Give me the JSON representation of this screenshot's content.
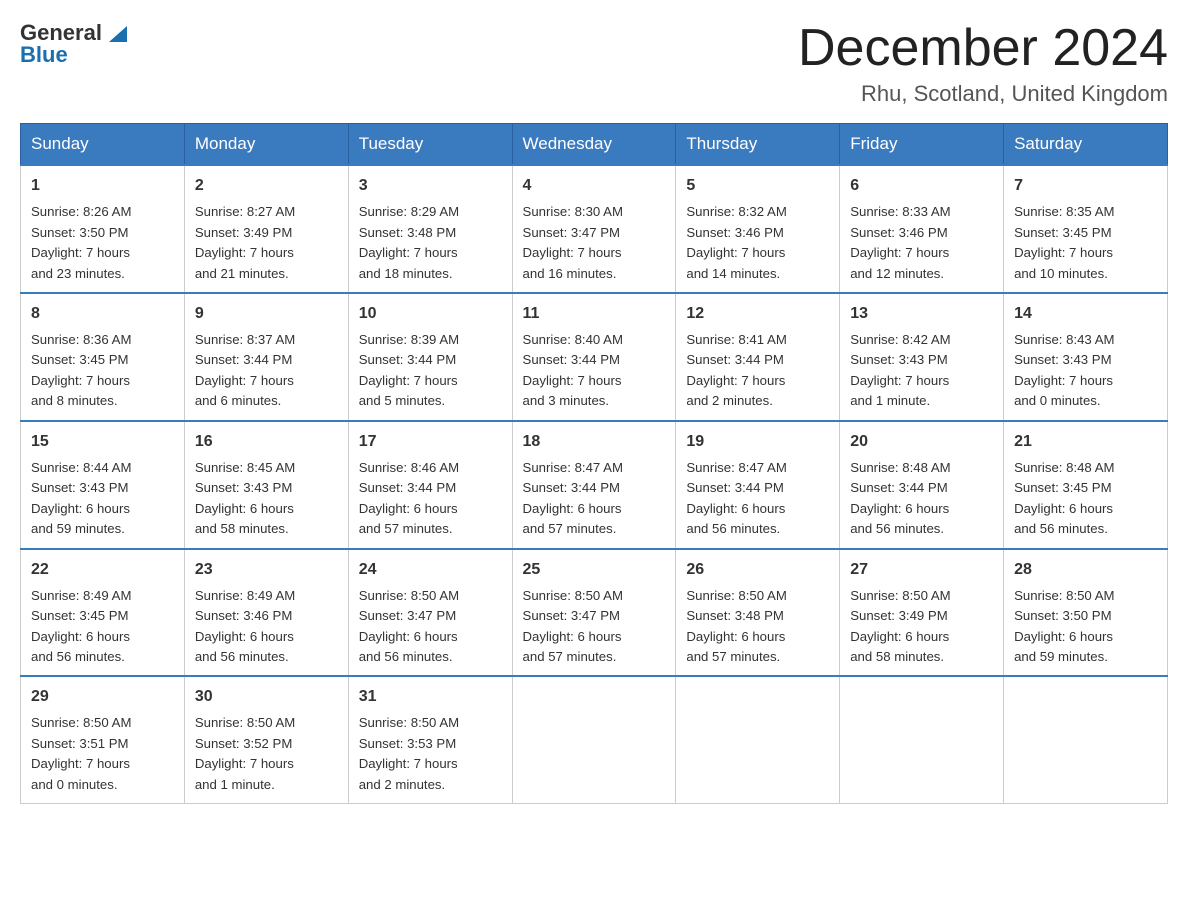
{
  "logo": {
    "text_general": "General",
    "text_blue": "Blue"
  },
  "title": "December 2024",
  "location": "Rhu, Scotland, United Kingdom",
  "days_of_week": [
    "Sunday",
    "Monday",
    "Tuesday",
    "Wednesday",
    "Thursday",
    "Friday",
    "Saturday"
  ],
  "weeks": [
    [
      {
        "date": "1",
        "sunrise": "8:26 AM",
        "sunset": "3:50 PM",
        "daylight": "7 hours and 23 minutes."
      },
      {
        "date": "2",
        "sunrise": "8:27 AM",
        "sunset": "3:49 PM",
        "daylight": "7 hours and 21 minutes."
      },
      {
        "date": "3",
        "sunrise": "8:29 AM",
        "sunset": "3:48 PM",
        "daylight": "7 hours and 18 minutes."
      },
      {
        "date": "4",
        "sunrise": "8:30 AM",
        "sunset": "3:47 PM",
        "daylight": "7 hours and 16 minutes."
      },
      {
        "date": "5",
        "sunrise": "8:32 AM",
        "sunset": "3:46 PM",
        "daylight": "7 hours and 14 minutes."
      },
      {
        "date": "6",
        "sunrise": "8:33 AM",
        "sunset": "3:46 PM",
        "daylight": "7 hours and 12 minutes."
      },
      {
        "date": "7",
        "sunrise": "8:35 AM",
        "sunset": "3:45 PM",
        "daylight": "7 hours and 10 minutes."
      }
    ],
    [
      {
        "date": "8",
        "sunrise": "8:36 AM",
        "sunset": "3:45 PM",
        "daylight": "7 hours and 8 minutes."
      },
      {
        "date": "9",
        "sunrise": "8:37 AM",
        "sunset": "3:44 PM",
        "daylight": "7 hours and 6 minutes."
      },
      {
        "date": "10",
        "sunrise": "8:39 AM",
        "sunset": "3:44 PM",
        "daylight": "7 hours and 5 minutes."
      },
      {
        "date": "11",
        "sunrise": "8:40 AM",
        "sunset": "3:44 PM",
        "daylight": "7 hours and 3 minutes."
      },
      {
        "date": "12",
        "sunrise": "8:41 AM",
        "sunset": "3:44 PM",
        "daylight": "7 hours and 2 minutes."
      },
      {
        "date": "13",
        "sunrise": "8:42 AM",
        "sunset": "3:43 PM",
        "daylight": "7 hours and 1 minute."
      },
      {
        "date": "14",
        "sunrise": "8:43 AM",
        "sunset": "3:43 PM",
        "daylight": "7 hours and 0 minutes."
      }
    ],
    [
      {
        "date": "15",
        "sunrise": "8:44 AM",
        "sunset": "3:43 PM",
        "daylight": "6 hours and 59 minutes."
      },
      {
        "date": "16",
        "sunrise": "8:45 AM",
        "sunset": "3:43 PM",
        "daylight": "6 hours and 58 minutes."
      },
      {
        "date": "17",
        "sunrise": "8:46 AM",
        "sunset": "3:44 PM",
        "daylight": "6 hours and 57 minutes."
      },
      {
        "date": "18",
        "sunrise": "8:47 AM",
        "sunset": "3:44 PM",
        "daylight": "6 hours and 57 minutes."
      },
      {
        "date": "19",
        "sunrise": "8:47 AM",
        "sunset": "3:44 PM",
        "daylight": "6 hours and 56 minutes."
      },
      {
        "date": "20",
        "sunrise": "8:48 AM",
        "sunset": "3:44 PM",
        "daylight": "6 hours and 56 minutes."
      },
      {
        "date": "21",
        "sunrise": "8:48 AM",
        "sunset": "3:45 PM",
        "daylight": "6 hours and 56 minutes."
      }
    ],
    [
      {
        "date": "22",
        "sunrise": "8:49 AM",
        "sunset": "3:45 PM",
        "daylight": "6 hours and 56 minutes."
      },
      {
        "date": "23",
        "sunrise": "8:49 AM",
        "sunset": "3:46 PM",
        "daylight": "6 hours and 56 minutes."
      },
      {
        "date": "24",
        "sunrise": "8:50 AM",
        "sunset": "3:47 PM",
        "daylight": "6 hours and 56 minutes."
      },
      {
        "date": "25",
        "sunrise": "8:50 AM",
        "sunset": "3:47 PM",
        "daylight": "6 hours and 57 minutes."
      },
      {
        "date": "26",
        "sunrise": "8:50 AM",
        "sunset": "3:48 PM",
        "daylight": "6 hours and 57 minutes."
      },
      {
        "date": "27",
        "sunrise": "8:50 AM",
        "sunset": "3:49 PM",
        "daylight": "6 hours and 58 minutes."
      },
      {
        "date": "28",
        "sunrise": "8:50 AM",
        "sunset": "3:50 PM",
        "daylight": "6 hours and 59 minutes."
      }
    ],
    [
      {
        "date": "29",
        "sunrise": "8:50 AM",
        "sunset": "3:51 PM",
        "daylight": "7 hours and 0 minutes."
      },
      {
        "date": "30",
        "sunrise": "8:50 AM",
        "sunset": "3:52 PM",
        "daylight": "7 hours and 1 minute."
      },
      {
        "date": "31",
        "sunrise": "8:50 AM",
        "sunset": "3:53 PM",
        "daylight": "7 hours and 2 minutes."
      },
      null,
      null,
      null,
      null
    ]
  ],
  "labels": {
    "sunrise": "Sunrise:",
    "sunset": "Sunset:",
    "daylight": "Daylight:"
  }
}
